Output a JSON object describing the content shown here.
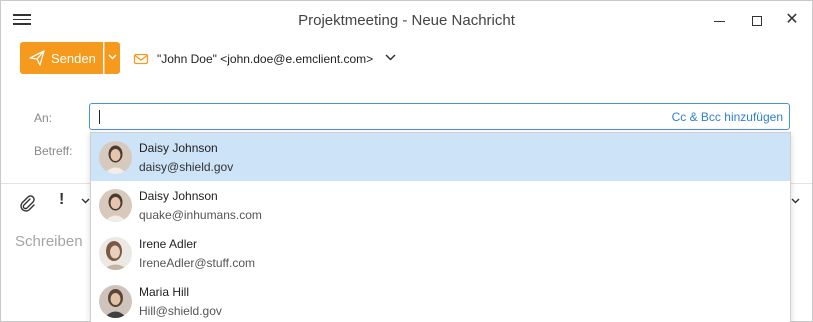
{
  "window": {
    "title": "Projektmeeting - Neue Nachricht",
    "controls": [
      "minimize-icon",
      "maximize-icon",
      "close-icon"
    ]
  },
  "toolbar": {
    "send_label": "Senden",
    "from_value": "\"John Doe\" <john.doe@e.emclient.com>"
  },
  "fields": {
    "to_label": "An:",
    "subject_label": "Betreff:",
    "cc_bcc_link": "Cc & Bcc hinzufügen"
  },
  "compose": {
    "placeholder": "Schreiben"
  },
  "suggestions": [
    {
      "name": "Daisy Johnson",
      "email": "daisy@shield.gov",
      "selected": true
    },
    {
      "name": "Daisy Johnson",
      "email": "quake@inhumans.com",
      "selected": false
    },
    {
      "name": "Irene Adler",
      "email": "IreneAdler@stuff.com",
      "selected": false
    },
    {
      "name": "Maria Hill",
      "email": "Hill@shield.gov",
      "selected": false
    }
  ],
  "colors": {
    "accent": "#f59a1c",
    "link": "#2f7fd1",
    "focus_border": "#4a90d9",
    "selection": "#cde3f7"
  }
}
